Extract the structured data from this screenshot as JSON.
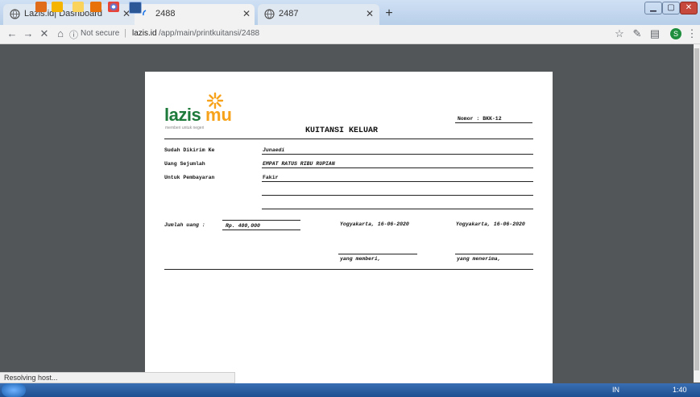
{
  "tabs": [
    {
      "title": "Lazis.id| Dashboard"
    },
    {
      "title": "2488"
    },
    {
      "title": "2487"
    }
  ],
  "toolbar": {
    "security_label": "Not secure",
    "separator": "|",
    "url_host": "lazis.id",
    "url_path": "/app/main/printkuitansi/2488",
    "profile_initial": "S"
  },
  "receipt": {
    "logo_main": "lazis",
    "logo_accent": "mu",
    "logo_tagline": "memberi untuk negeri",
    "nomor_label": "Nomor : BKK-12",
    "title": "KUITANSI KELUAR",
    "fields": [
      {
        "label": "Sudah Dikirim Ke",
        "value": "Junaedi"
      },
      {
        "label": "Uang Sejumlah",
        "value": "EMPAT RATUS RIBU RUPIAN"
      },
      {
        "label": "Untuk Pembayaran",
        "value": "Fakir"
      }
    ],
    "jumlah_label": "Jumlah uang :",
    "jumlah_value": "Rp. 400,000",
    "date_left": "Yogyakarta, 16-06-2020",
    "date_right": "Yogyakarta, 16-06-2020",
    "signer_left": "yang memberi,",
    "signer_right": "yang menerima,"
  },
  "status": {
    "text": "Resolving host..."
  },
  "taskbar": {
    "lang": "IN",
    "time": "1:40"
  },
  "colors": {
    "brand_orange": "#f7a21b",
    "brand_green": "#1d7a3a",
    "frame_blue": "#b8cfe9"
  }
}
